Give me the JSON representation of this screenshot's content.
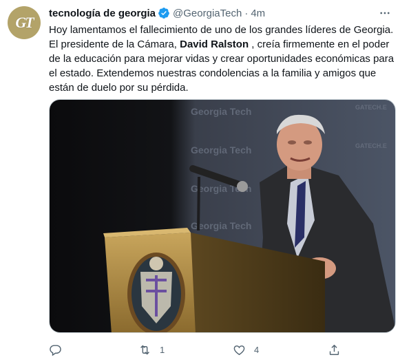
{
  "tweet": {
    "display_name": "tecnología de georgia",
    "handle": "@GeorgiaTech",
    "separator": "·",
    "time": "4m",
    "avatar_text": "GT",
    "text_part1": "Hoy lamentamos el fallecimiento de uno de los grandes líderes de Georgia. El presidente de la Cámara, ",
    "text_bold": "David Ralston",
    "text_part2": " , creía firmemente en el poder de la educación para mejorar vidas y crear oportunidades económicas para el estado. Extendemos nuestras condolencias a la familia y amigos que están de duelo por su pérdida.",
    "media": {
      "backdrop_texts": [
        "Georgia Tech",
        "Georgia Tech",
        "Georgia Tech",
        "Georgia Tech"
      ],
      "backdrop_url": "GATECH.E"
    },
    "actions": {
      "reply_count": "",
      "retweet_count": "1",
      "like_count": "4"
    }
  },
  "colors": {
    "accent": "#1d9bf0",
    "secondary_text": "#536471",
    "gt_gold": "#b3a369"
  }
}
